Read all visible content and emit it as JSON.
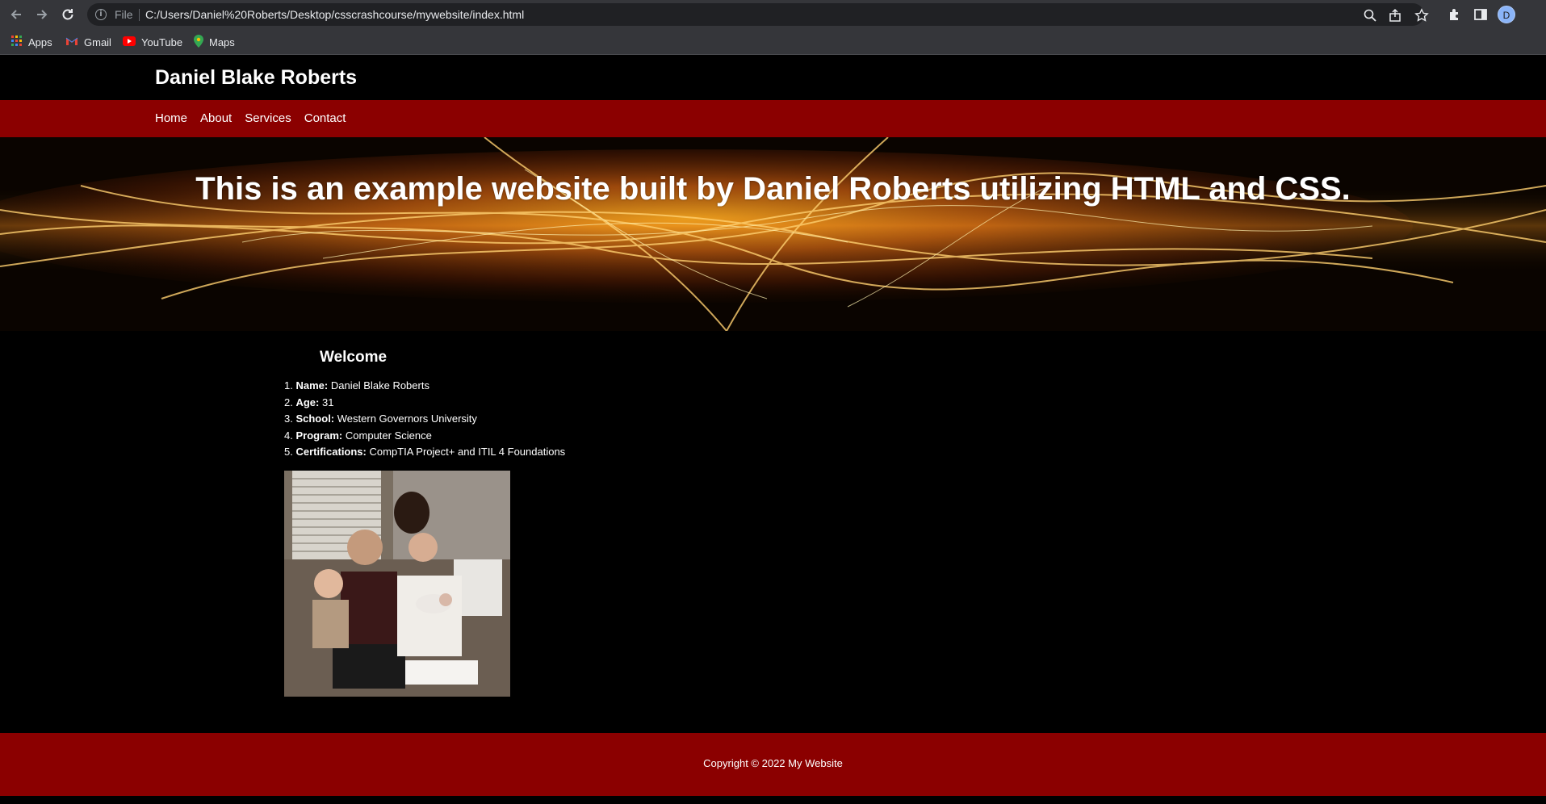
{
  "browser": {
    "url_scheme_label": "File",
    "url": "C:/Users/Daniel%20Roberts/Desktop/csscrashcourse/mywebsite/index.html",
    "profile_initial": "D",
    "bookmarks": [
      {
        "label": "Apps",
        "icon": "apps-grid-icon"
      },
      {
        "label": "Gmail",
        "icon": "gmail-icon"
      },
      {
        "label": "YouTube",
        "icon": "youtube-icon"
      },
      {
        "label": "Maps",
        "icon": "maps-icon"
      }
    ]
  },
  "site": {
    "title": "Daniel Blake Roberts",
    "nav": [
      "Home",
      "About",
      "Services",
      "Contact"
    ],
    "hero_text": "This is an example website built by Daniel Roberts utilizing HTML and CSS.",
    "welcome_heading": "Welcome",
    "details": [
      {
        "num": "1.",
        "label": "Name:",
        "value": "Daniel Blake Roberts"
      },
      {
        "num": "2.",
        "label": "Age:",
        "value": "31"
      },
      {
        "num": "3.",
        "label": "School:",
        "value": "Western Governors University"
      },
      {
        "num": "4.",
        "label": "Program:",
        "value": "Computer Science"
      },
      {
        "num": "5.",
        "label": "Certifications:",
        "value": "CompTIA Project+ and ITIL 4 Foundations"
      }
    ],
    "footer": "Copyright © 2022 My Website"
  },
  "colors": {
    "nav_bg": "#8b0000",
    "footer_bg": "#8b0000",
    "page_bg": "#000000"
  }
}
